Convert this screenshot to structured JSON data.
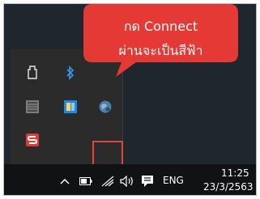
{
  "callout": {
    "line1": "กด Connect",
    "line2": "ผ่านจะเป็นสีฟ้า",
    "color": "#e53935"
  },
  "tray_flyout": {
    "icons": [
      "usb-drive-icon",
      "bluetooth-icon",
      "keyboard-app-icon",
      "app-icon",
      "vpn-globe-icon",
      "sogou-input-icon"
    ],
    "highlight_color": "#e8413c"
  },
  "taskbar": {
    "icons": [
      "chevron-up-icon",
      "battery-icon",
      "wifi-icon",
      "volume-icon",
      "notification-icon"
    ],
    "language": "ENG",
    "time": "11:25",
    "date": "23/3/2563"
  }
}
